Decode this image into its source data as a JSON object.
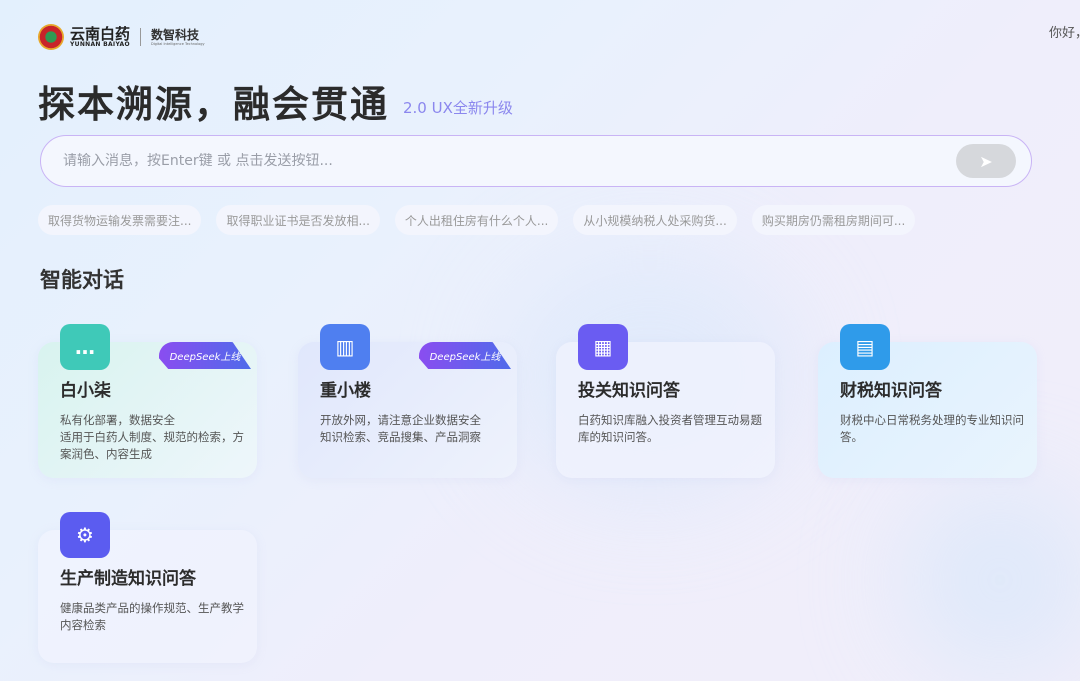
{
  "header": {
    "logo_cn": "云南白药",
    "logo_en": "YUNNAN BAIYAO",
    "logo_sub": "数智科技",
    "logo_sub_en": "Digital Intelligence Technology",
    "greeting": "你好，"
  },
  "hero": {
    "title": "探本溯源，融会贯通",
    "version": "2.0 UX全新升级"
  },
  "search": {
    "placeholder": "请输入消息，按Enter键 或 点击发送按钮...",
    "value": "",
    "send_icon": "send-icon"
  },
  "suggestions": [
    "取得货物运输发票需要注...",
    "取得职业证书是否发放相...",
    "个人出租住房有什么个人...",
    "从小规模纳税人处采购货...",
    "购买期房仍需租房期间可..."
  ],
  "section_title": "智能对话",
  "cards": [
    {
      "title": "白小柒",
      "desc": "私有化部署，数据安全\n适用于白药人制度、规范的检索，方案润色、内容生成",
      "badge": "DeepSeek上线",
      "icon": "chat-icon",
      "color": "#3fc9b8"
    },
    {
      "title": "重小楼",
      "desc": "开放外网，请注意企业数据安全\n知识检索、竞品搜集、产品洞察",
      "badge": "DeepSeek上线",
      "icon": "book-icon",
      "color": "#4f7ff0"
    },
    {
      "title": "投关知识问答",
      "desc": "白药知识库融入投资者管理互动易题库的知识问答。",
      "icon": "apps-icon",
      "color": "#6a5cf2"
    },
    {
      "title": "财税知识问答",
      "desc": "财税中心日常税务处理的专业知识问答。",
      "icon": "tax-document-icon",
      "color": "#2f9bea"
    },
    {
      "title": "生产制造知识问答",
      "desc": "健康品类产品的操作规范、生产教学内容检索",
      "icon": "factory-icon",
      "color": "#5b5cf0"
    }
  ]
}
